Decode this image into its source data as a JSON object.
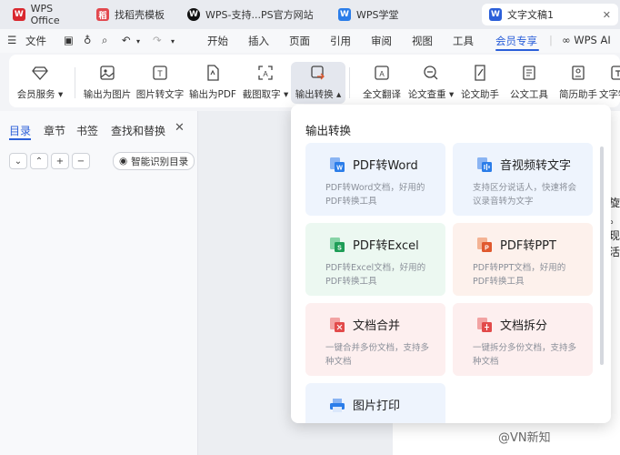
{
  "tabs": [
    {
      "label": "WPS Office",
      "icon": "wps-logo-icon",
      "color": "#d9282f"
    },
    {
      "label": "找稻壳模板",
      "icon": "docer-icon",
      "color": "#e2484e"
    },
    {
      "label": "WPS-支持...PS官方网站",
      "icon": "wps-globe-icon",
      "color": "#111111"
    },
    {
      "label": "WPS学堂",
      "icon": "wps-school-icon",
      "color": "#2b7de9"
    },
    {
      "label": "文字文稿1",
      "icon": "word-doc-icon",
      "color": "#2b5fd9"
    }
  ],
  "menubar": {
    "file": "文件",
    "items": [
      "开始",
      "插入",
      "页面",
      "引用",
      "审阅",
      "视图",
      "工具",
      "会员专享"
    ],
    "active": "会员专享",
    "wps_ai": "WPS AI"
  },
  "ribbon": {
    "buttons": [
      {
        "label": "会员服务",
        "icon": "member-diamond-icon",
        "dropdown": true
      },
      {
        "label": "输出为图片",
        "icon": "export-image-icon"
      },
      {
        "label": "图片转文字",
        "icon": "image-to-text-icon"
      },
      {
        "label": "输出为PDF",
        "icon": "export-pdf-icon"
      },
      {
        "label": "截图取字",
        "icon": "screenshot-ocr-icon",
        "dropdown": true
      },
      {
        "label": "输出转换",
        "icon": "convert-icon",
        "dropdown": true,
        "active": true
      },
      {
        "label": "全文翻译",
        "icon": "translate-icon"
      },
      {
        "label": "论文查重",
        "icon": "plagiarism-check-icon",
        "dropdown": true
      },
      {
        "label": "论文助手",
        "icon": "paper-assistant-icon"
      },
      {
        "label": "公文工具",
        "icon": "official-doc-icon"
      },
      {
        "label": "简历助手",
        "icon": "resume-icon"
      },
      {
        "label": "文字特色",
        "icon": "text-feature-icon"
      }
    ]
  },
  "sidebar": {
    "tabs": [
      "目录",
      "章节",
      "书签",
      "查找和替换"
    ],
    "active": "目录",
    "smart_button": "智能识别目录"
  },
  "panel": {
    "title": "输出转换",
    "cards": [
      {
        "title": "PDF转Word",
        "desc": "PDF转Word文档，好用的PDF转换工具",
        "icon": "pdf-to-word-icon",
        "bg": "#eef4fd",
        "color": "#2b7de9"
      },
      {
        "title": "音视频转文字",
        "desc": "支持区分说话人，快速将会议录音转为文字",
        "icon": "audio-to-text-icon",
        "bg": "#eef4fd",
        "color": "#2b7de9"
      },
      {
        "title": "PDF转Excel",
        "desc": "PDF转Excel文档，好用的PDF转换工具",
        "icon": "pdf-to-excel-icon",
        "bg": "#ecf8f1",
        "color": "#1f9d57"
      },
      {
        "title": "PDF转PPT",
        "desc": "PDF转PPT文档，好用的PDF转换工具",
        "icon": "pdf-to-ppt-icon",
        "bg": "#fdf1ec",
        "color": "#e0592e"
      },
      {
        "title": "文档合并",
        "desc": "一键合并多份文档，支持多种文档",
        "icon": "doc-merge-icon",
        "bg": "#fdefef",
        "color": "#e24a4a"
      },
      {
        "title": "文档拆分",
        "desc": "一键拆分多份文档，支持多种文档",
        "icon": "doc-split-icon",
        "bg": "#fdefef",
        "color": "#e24a4a"
      },
      {
        "title": "图片打印",
        "desc": "",
        "icon": "image-print-icon",
        "bg": "#eef4fd",
        "color": "#2b7de9"
      }
    ]
  },
  "page_text": [
    "旋",
    "。",
    "现",
    "活"
  ],
  "watermark": "@VN新知"
}
